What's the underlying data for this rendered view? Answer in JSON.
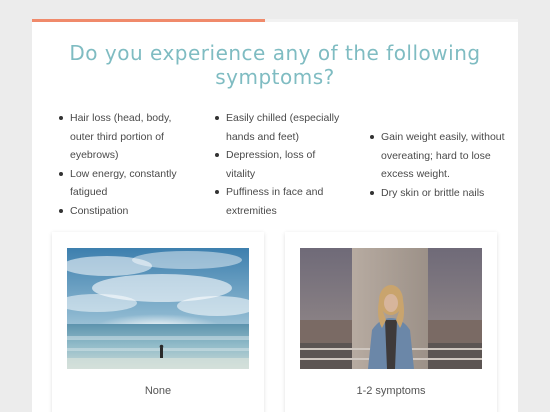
{
  "quiz": {
    "progress_fraction": 0.48,
    "question": "Do you experience any of the following symptoms?",
    "symptom_columns": [
      [
        "Hair loss (head, body, outer third portion of eyebrows)",
        "Low energy, constantly fatigued",
        "Constipation"
      ],
      [
        "Easily chilled (especially hands and feet)",
        "Depression, loss of vitality",
        "Puffiness in face and extremities"
      ],
      [
        "Gain weight easily, without overeating; hard to lose excess weight.",
        "Dry skin or brittle nails"
      ]
    ],
    "options": [
      {
        "label": "None",
        "image": "beach-ocean-person-photo"
      },
      {
        "label": "1-2 symptoms",
        "image": "woman-denim-jacket-portrait-photo"
      }
    ]
  },
  "colors": {
    "accent": "#f08a6b",
    "question_text": "#7fbcc2",
    "page_background": "#ececec"
  }
}
